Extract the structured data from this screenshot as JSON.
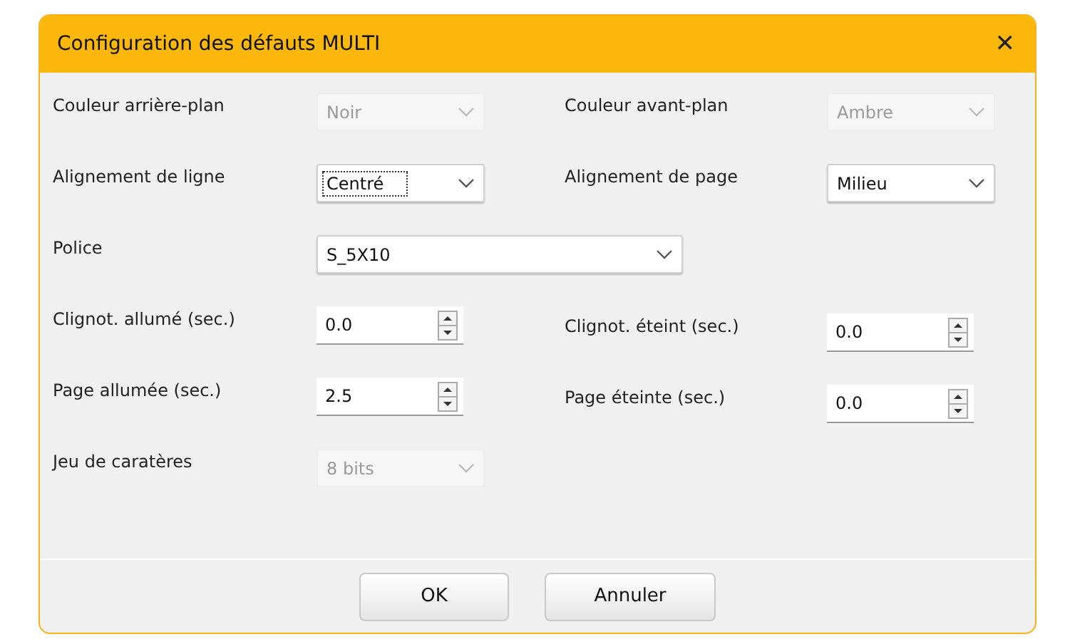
{
  "window": {
    "title": "Configuration des défauts MULTI",
    "close": "✕"
  },
  "rows": [
    {
      "fields": [
        {
          "label": "Couleur arrière-plan",
          "kind": "combo",
          "value": "Noir",
          "disabled": true,
          "focused": false
        },
        {
          "label": "Couleur avant-plan",
          "kind": "combo",
          "value": "Ambre",
          "disabled": true,
          "focused": false
        }
      ]
    },
    {
      "fields": [
        {
          "label": "Alignement de ligne",
          "kind": "combo",
          "value": "Centré",
          "disabled": false,
          "focused": true
        },
        {
          "label": "Alignement de page",
          "kind": "combo",
          "value": "Milieu",
          "disabled": false,
          "focused": false
        }
      ]
    },
    {
      "fields": [
        {
          "label": "Police",
          "kind": "combo",
          "value": "S_5X10",
          "disabled": false,
          "focused": false
        }
      ]
    },
    {
      "fields": [
        {
          "label": "Clignot. allumé (sec.)",
          "kind": "spin",
          "value": "0.0",
          "disabled": false,
          "focused": false
        },
        {
          "label": "Clignot. éteint (sec.)",
          "kind": "spin",
          "value": "0.0",
          "disabled": false,
          "focused": false
        }
      ]
    },
    {
      "fields": [
        {
          "label": "Page allumée (sec.)",
          "kind": "spin",
          "value": "2.5",
          "disabled": false,
          "focused": false
        },
        {
          "label": "Page éteinte (sec.)",
          "kind": "spin",
          "value": "0.0",
          "disabled": false,
          "focused": false
        }
      ]
    },
    {
      "fields": [
        {
          "label": "Jeu de caratères",
          "kind": "combo",
          "value": "8 bits",
          "disabled": true,
          "focused": false
        }
      ]
    }
  ],
  "buttons": [
    "OK",
    "Annuler"
  ]
}
